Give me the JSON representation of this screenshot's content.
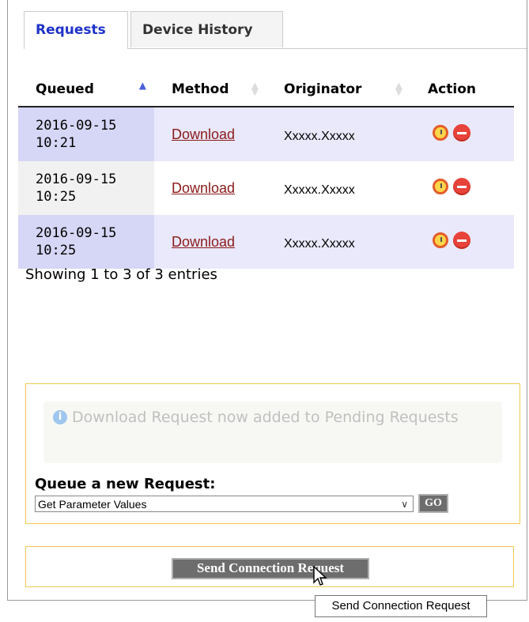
{
  "tabs": [
    {
      "label": "Requests",
      "active": true
    },
    {
      "label": "Device History",
      "active": false
    }
  ],
  "table": {
    "headers": {
      "queued": "Queued",
      "method": "Method",
      "originator": "Originator",
      "action": "Action"
    },
    "rows": [
      {
        "queued_date": "2016-09-15",
        "queued_time": "10:21",
        "method": "Download",
        "originator": "Xxxxx.Xxxxx"
      },
      {
        "queued_date": "2016-09-15",
        "queued_time": "10:25",
        "method": "Download",
        "originator": "Xxxxx.Xxxxx"
      },
      {
        "queued_date": "2016-09-15",
        "queued_time": "10:25",
        "method": "Download",
        "originator": "Xxxxx.Xxxxx"
      }
    ],
    "info": "Showing 1 to 3 of 3 entries",
    "action_icons": [
      "alarm-clock-icon",
      "remove-icon"
    ]
  },
  "queue": {
    "notice": "Download Request now added to Pending Requests",
    "label": "Queue a new Request:",
    "selected": "Get Parameter Values",
    "go_label": "GO"
  },
  "send": {
    "button_label": "Send Connection Request",
    "tooltip": "Send Connection Request"
  },
  "colors": {
    "tab_active": "#1f33c9",
    "link": "#8b1a1a",
    "row_odd": "#e9e9fb",
    "box_border": "#f0c850",
    "button_bg": "#6d6d6d"
  }
}
